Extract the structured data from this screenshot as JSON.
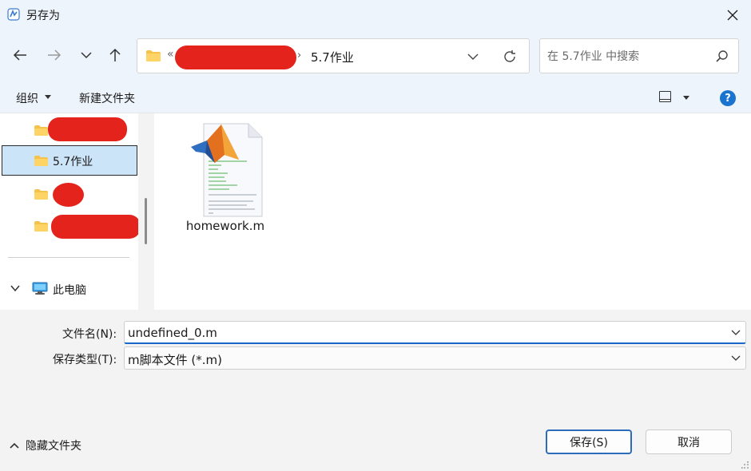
{
  "window": {
    "title": "另存为",
    "app_icon": "matlab-app-icon",
    "close_icon": "close-icon"
  },
  "nav": {
    "back_icon": "arrow-left-icon",
    "forward_icon": "arrow-right-icon",
    "recent_icon": "chevron-down-icon",
    "up_icon": "arrow-up-icon",
    "breadcrumb_overflow": "«",
    "breadcrumb_separator": "›",
    "current_folder": "5.7作业",
    "refresh_icon": "refresh-icon"
  },
  "search": {
    "placeholder": "在 5.7作业 中搜索",
    "icon": "search-icon"
  },
  "toolbar": {
    "organize_label": "组织",
    "new_folder_label": "新建文件夹",
    "view_icon": "view-layout-icon",
    "help_label": "?"
  },
  "sidebar": {
    "items": [
      {
        "label": "",
        "redacted": true
      },
      {
        "label": "5.7作业",
        "selected": true
      },
      {
        "label": "",
        "redacted": true
      },
      {
        "label": "",
        "redacted": true
      }
    ],
    "this_pc_label": "此电脑"
  },
  "files": [
    {
      "name": "homework.m",
      "icon": "matlab-file-icon"
    }
  ],
  "form": {
    "filename_label": "文件名(N):",
    "filename_value": "undefined_0.m",
    "filetype_label": "保存类型(T):",
    "filetype_value": "m脚本文件 (*.m)"
  },
  "footer": {
    "hide_folders_label": "隐藏文件夹",
    "save_label": "保存(S)",
    "cancel_label": "取消"
  },
  "colors": {
    "title_bg": "#eef4fb",
    "selection": "#cce4f7",
    "accent": "#1b66c9",
    "redaction": "#e5231d",
    "folder": "#f6c24a"
  }
}
